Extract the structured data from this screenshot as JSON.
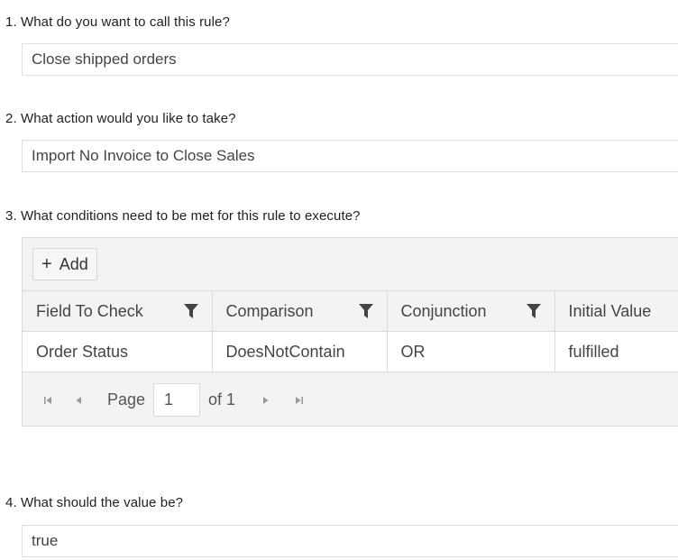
{
  "questions": {
    "q1": "1. What do you want to call this rule?",
    "q2": "2. What action would you like to take?",
    "q3": "3. What conditions need to be met for this rule to execute?",
    "q4": "4. What should the value be?"
  },
  "rule_name": {
    "value": "Close shipped orders"
  },
  "action": {
    "value": "Import No Invoice to Close Sales"
  },
  "conditions": {
    "add_label": "Add",
    "columns": [
      "Field To Check",
      "Comparison",
      "Conjunction",
      "Initial Value"
    ],
    "rows": [
      [
        "Order Status",
        "DoesNotContain",
        "OR",
        "fulfilled"
      ]
    ],
    "pager": {
      "page_label": "Page",
      "current_page": "1",
      "of_label": "of 1"
    }
  },
  "value": {
    "value": "true"
  },
  "icons": {
    "add": "plus-icon",
    "filter": "filter-icon",
    "first": "first-page-icon",
    "prev": "prev-page-icon",
    "next": "next-page-icon",
    "last": "last-page-icon"
  }
}
